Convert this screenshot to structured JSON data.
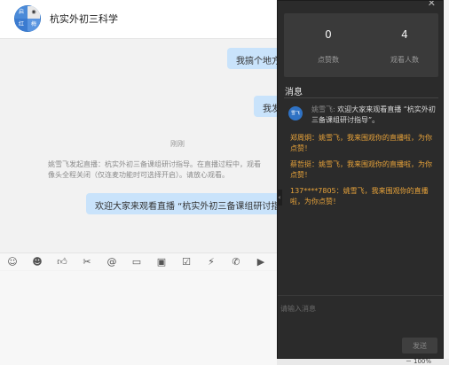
{
  "chat": {
    "title": "杭实外初三科学",
    "avatar_text": [
      "",
      "",
      "",
      ""
    ],
    "messages": [
      {
        "text": "我搞个地方"
      },
      {
        "text": "我发"
      },
      {
        "text": "欢迎大家来观看直播 “杭实外初三备课组研讨指"
      }
    ],
    "time_label": "刚刚",
    "system_notice": [
      "姚雪飞发起直播：杭实外初三备课组研讨指导。在直播过程中，观看",
      "像头全程关闭（仅连麦功能时可选择开启）。请放心观看。"
    ]
  },
  "toolbar": {
    "icons": [
      "emoji-icon",
      "smile-icon",
      "thumbs-up-icon",
      "scissors-icon",
      "at-icon",
      "folder-icon",
      "calendar-icon",
      "checkbox-icon",
      "lightning-icon",
      "phone-icon",
      "video-icon"
    ]
  },
  "live": {
    "likes_count": "0",
    "likes_label": "点赞数",
    "viewers_count": "4",
    "viewers_label": "观看人数",
    "messages_heading": "消息",
    "host_avatar_text": "雪飞",
    "host_message": {
      "who": "姚雪飞:",
      "text": " 欢迎大家来观看直播 “杭实外初三备课组研讨指导”。"
    },
    "user_messages": [
      "郑周炯：姚雪飞，我来围观你的直播啦，为你点赞！",
      "蔡哲挺：姚雪飞，我来围观你的直播啦，为你点赞！",
      "137****7805：姚雪飞，我来围观你的直播啦，为你点赞！"
    ],
    "input_placeholder": "请输入消息",
    "send_label": "发送"
  },
  "status": {
    "zoom": "100%"
  },
  "colors": {
    "bubble": "#c9e3fb",
    "panel_bg": "#2b2b2b",
    "accent_orange": "#e8a33a",
    "brand_blue": "#2f72c4"
  }
}
